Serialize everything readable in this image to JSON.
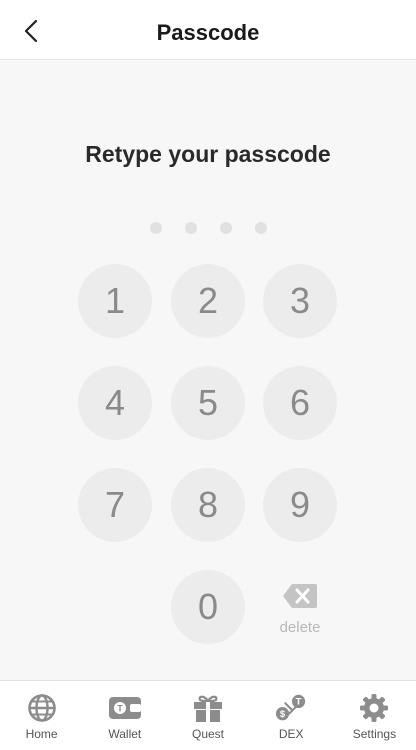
{
  "header": {
    "title": "Passcode"
  },
  "prompt": "Retype your passcode",
  "keypad": {
    "keys": [
      "1",
      "2",
      "3",
      "4",
      "5",
      "6",
      "7",
      "8",
      "9",
      "0"
    ],
    "delete_label": "delete"
  },
  "tabbar": {
    "items": [
      {
        "label": "Home",
        "icon": "globe-icon"
      },
      {
        "label": "Wallet",
        "icon": "wallet-icon"
      },
      {
        "label": "Quest",
        "icon": "gift-icon"
      },
      {
        "label": "DEX",
        "icon": "exchange-icon"
      },
      {
        "label": "Settings",
        "icon": "gear-icon"
      }
    ]
  }
}
